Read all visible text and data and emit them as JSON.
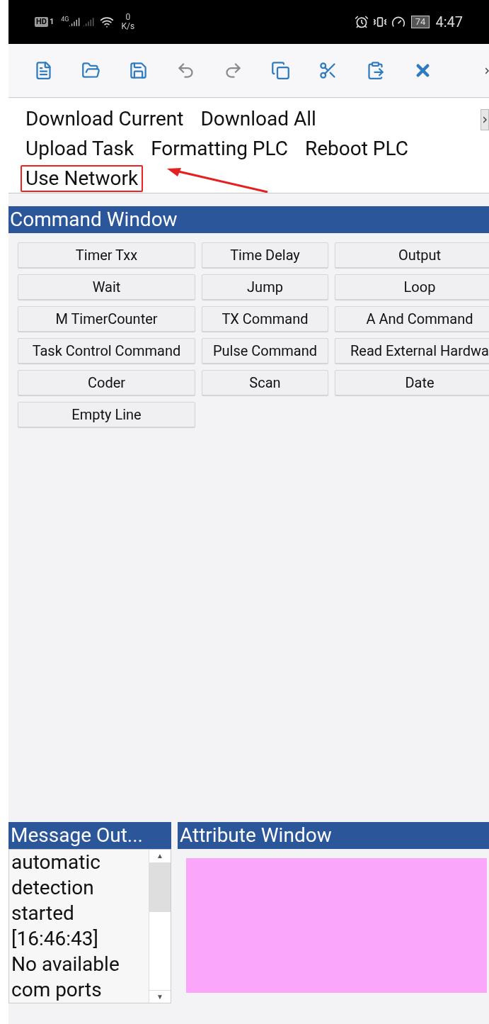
{
  "status_bar": {
    "hd": "HD",
    "sim": "1",
    "network": "4G",
    "speed_value": "0",
    "speed_unit": "K/s",
    "battery": "74",
    "time": "4:47"
  },
  "toolbar": {
    "tools": [
      {
        "kind": "new",
        "disabled": false
      },
      {
        "kind": "open",
        "disabled": false
      },
      {
        "kind": "save",
        "disabled": false
      },
      {
        "kind": "undo",
        "disabled": true
      },
      {
        "kind": "redo",
        "disabled": true
      },
      {
        "kind": "copy",
        "disabled": false
      },
      {
        "kind": "cut",
        "disabled": false
      },
      {
        "kind": "paste",
        "disabled": false
      },
      {
        "kind": "delete",
        "disabled": false
      }
    ]
  },
  "menu": {
    "rows": [
      [
        {
          "label": "Download Current",
          "selected": false
        },
        {
          "label": "Download All",
          "selected": false
        }
      ],
      [
        {
          "label": "Upload Task",
          "selected": false
        },
        {
          "label": "Formatting PLC",
          "selected": false
        },
        {
          "label": "Reboot PLC",
          "selected": false
        }
      ],
      [
        {
          "label": "Use Network",
          "selected": true
        }
      ]
    ]
  },
  "command_window": {
    "title": "Command Window",
    "buttons": [
      [
        "Timer Txx",
        "Time Delay",
        "Output"
      ],
      [
        "Wait",
        "Jump",
        "Loop"
      ],
      [
        "M TimerCounter",
        "TX Command",
        "A And Command"
      ],
      [
        "Task Control Command",
        "Pulse Command",
        "Read External Hardwa"
      ],
      [
        "Coder",
        "Scan",
        "Date"
      ],
      [
        "Empty Line"
      ]
    ]
  },
  "message_output": {
    "title": "Message Out...",
    "lines": [
      "automatic",
      "detection",
      "started",
      "[16:46:43]",
      "No available",
      "com ports"
    ],
    "up": "▲",
    "down": "▼"
  },
  "attribute_window": {
    "title": "Attribute Window"
  }
}
